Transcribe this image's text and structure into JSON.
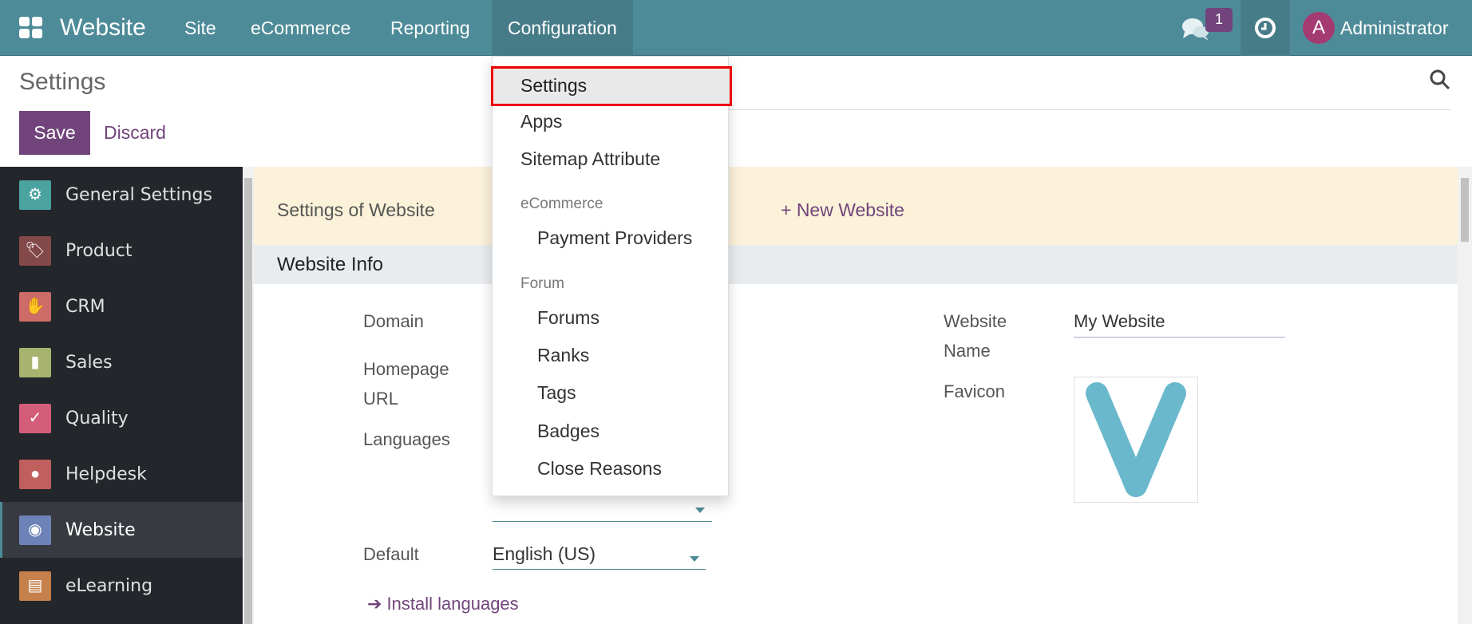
{
  "navbar": {
    "app_name": "Website",
    "menus": [
      "Site",
      "eCommerce",
      "Reporting",
      "Configuration"
    ],
    "active_menu": "Configuration",
    "messages_count": "1",
    "user_initial": "A",
    "user_name": "Administrator",
    "color": "#4e8b98"
  },
  "page": {
    "title": "Settings",
    "save_label": "Save",
    "discard_label": "Discard"
  },
  "sidebar": {
    "items": [
      {
        "label": "General Settings",
        "icon": "gear-icon",
        "color": "#4aa3a0"
      },
      {
        "label": "Product",
        "icon": "tags-icon",
        "color": "#834848"
      },
      {
        "label": "CRM",
        "icon": "handshake-icon",
        "color": "#cc6b67"
      },
      {
        "label": "Sales",
        "icon": "chart-icon",
        "color": "#a7b36e"
      },
      {
        "label": "Quality",
        "icon": "check-badge-icon",
        "color": "#d35d7a"
      },
      {
        "label": "Helpdesk",
        "icon": "support-agent-icon",
        "color": "#c0605e"
      },
      {
        "label": "Website",
        "icon": "globe-cursor-icon",
        "color": "#6d83b8",
        "active": true
      },
      {
        "label": "eLearning",
        "icon": "presentation-icon",
        "color": "#c6804c"
      }
    ]
  },
  "banner": {
    "label": "Settings of Website",
    "new_website": "+ New Website"
  },
  "section": {
    "title": "Website Info"
  },
  "fields": {
    "domain": "Domain",
    "homepage_url": "Homepage URL",
    "languages": "Languages",
    "default": "Default",
    "default_value": "English (US)",
    "install_languages": "Install languages",
    "website_name": "Website Name",
    "website_name_value": "My Website",
    "favicon": "Favicon"
  },
  "dropdown": {
    "items": [
      "Settings",
      "Apps",
      "Sitemap Attribute"
    ],
    "selected": "Settings",
    "groups": [
      {
        "header": "eCommerce",
        "items": [
          "Payment Providers"
        ]
      },
      {
        "header": "Forum",
        "items": [
          "Forums",
          "Ranks",
          "Tags",
          "Badges",
          "Close Reasons"
        ]
      }
    ]
  }
}
